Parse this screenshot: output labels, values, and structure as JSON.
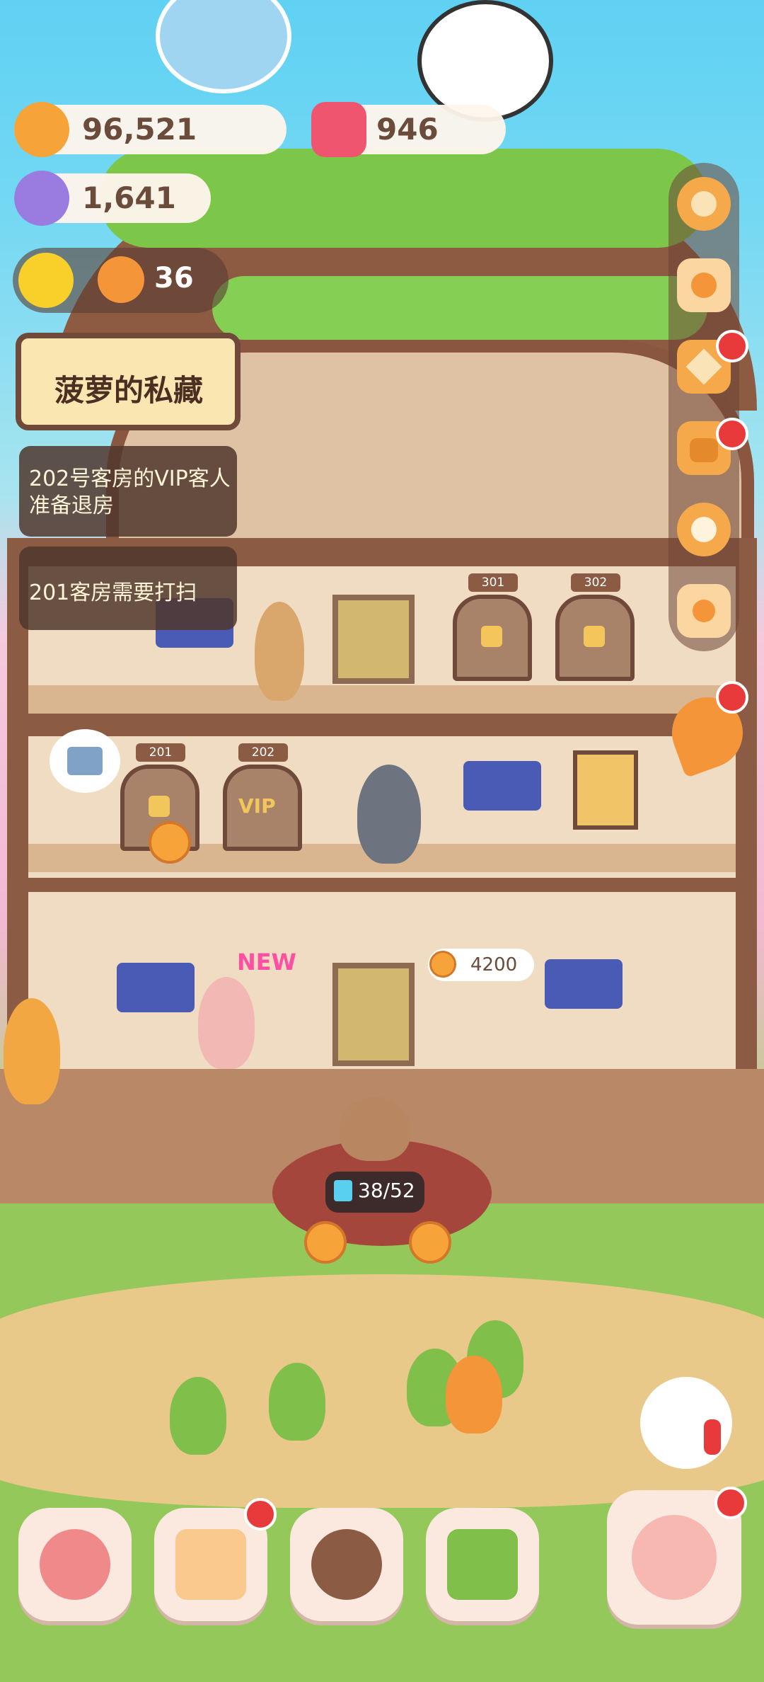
{
  "resources": {
    "cookies": "96,521",
    "candles": "946",
    "gems": "1,641",
    "helpers": "36"
  },
  "banner": {
    "title": "菠萝的私藏"
  },
  "tasks": [
    {
      "text": "202号客房的VIP客人准备退房"
    },
    {
      "text": "201客房需要打扫"
    }
  ],
  "rooms": {
    "floor3": [
      "301",
      "302"
    ],
    "floor2": [
      "201",
      "202"
    ],
    "vip_label": "VIP"
  },
  "badges": {
    "new_label": "NEW",
    "price": "4200",
    "energy": "38/52"
  },
  "sidebar": {
    "items": [
      {
        "icon": "gear-icon",
        "has_dot": false
      },
      {
        "icon": "stamp-card-icon",
        "has_dot": false
      },
      {
        "icon": "star-gift-icon",
        "has_dot": true
      },
      {
        "icon": "backpack-icon",
        "has_dot": true
      },
      {
        "icon": "characters-icon",
        "has_dot": false
      },
      {
        "icon": "camera-icon",
        "has_dot": false
      }
    ]
  },
  "bottom_nav": [
    {
      "icon": "mushroom-house-icon",
      "has_dot": false
    },
    {
      "icon": "notebook-heart-icon",
      "has_dot": true
    },
    {
      "icon": "cookie-portrait-icon",
      "has_dot": false
    },
    {
      "icon": "shop-stall-icon",
      "has_dot": false
    },
    {
      "icon": "alarm-fish-icon",
      "has_dot": true
    }
  ],
  "colors": {
    "sky": "#5fd1f3",
    "accent_orange": "#f6a43a",
    "notification_red": "#e83a3a",
    "wood": "#8c5b44",
    "grass": "#95c85a"
  }
}
